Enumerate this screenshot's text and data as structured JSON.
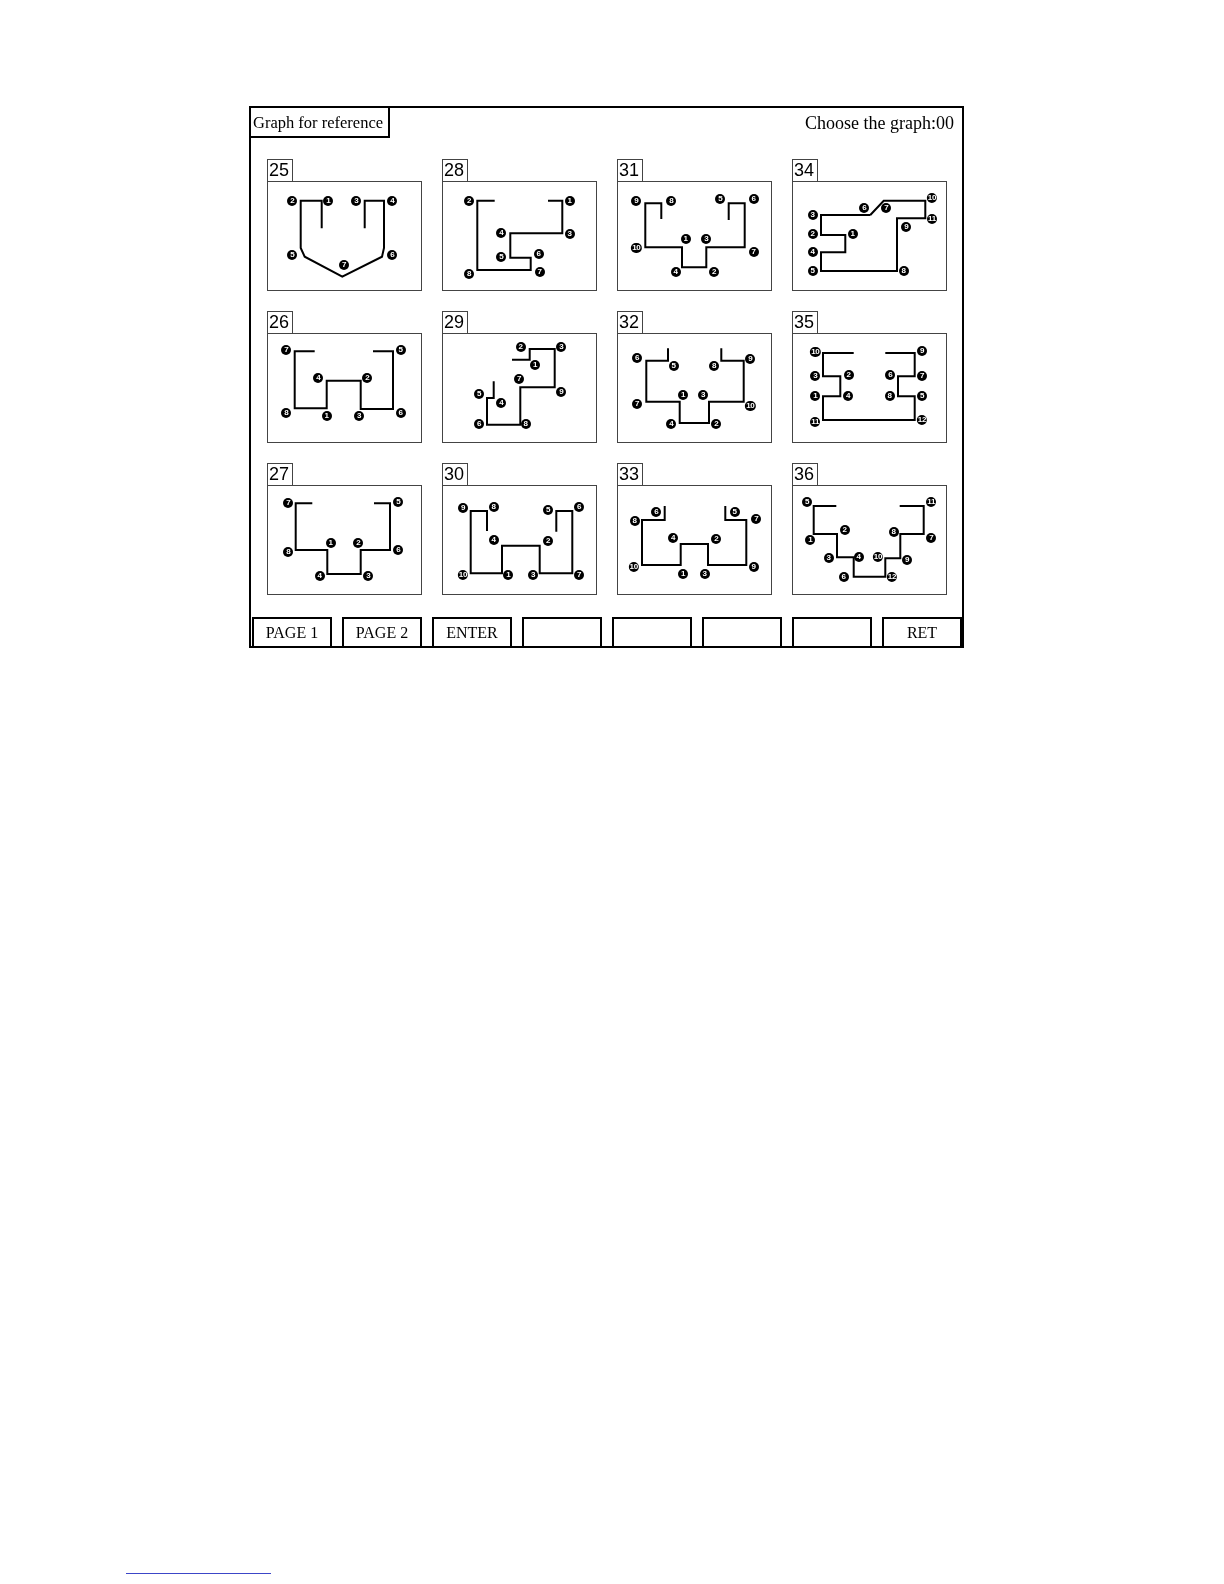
{
  "header": {
    "title": "Graph for reference",
    "prompt": "Choose the graph:00"
  },
  "graphs": [
    {
      "number": "25",
      "nodes": [
        "2",
        "1",
        "3",
        "4",
        "5",
        "6",
        "7"
      ]
    },
    {
      "number": "28",
      "nodes": [
        "2",
        "1",
        "4",
        "3",
        "5",
        "6",
        "8",
        "7"
      ]
    },
    {
      "number": "31",
      "nodes": [
        "9",
        "8",
        "5",
        "6",
        "10",
        "1",
        "3",
        "7",
        "4",
        "2"
      ]
    },
    {
      "number": "34",
      "nodes": [
        "10",
        "6",
        "7",
        "3",
        "11",
        "9",
        "2",
        "1",
        "4",
        "5",
        "8"
      ]
    },
    {
      "number": "26",
      "nodes": [
        "7",
        "5",
        "4",
        "2",
        "8",
        "6",
        "1",
        "3"
      ]
    },
    {
      "number": "29",
      "nodes": [
        "2",
        "3",
        "1",
        "7",
        "9",
        "5",
        "4",
        "6",
        "8"
      ]
    },
    {
      "number": "32",
      "nodes": [
        "6",
        "9",
        "5",
        "8",
        "1",
        "3",
        "7",
        "10",
        "4",
        "2"
      ]
    },
    {
      "number": "35",
      "nodes": [
        "10",
        "9",
        "3",
        "2",
        "6",
        "7",
        "1",
        "4",
        "8",
        "5",
        "11",
        "12"
      ]
    },
    {
      "number": "27",
      "nodes": [
        "7",
        "5",
        "1",
        "2",
        "8",
        "6",
        "4",
        "3"
      ]
    },
    {
      "number": "30",
      "nodes": [
        "9",
        "8",
        "5",
        "6",
        "4",
        "2",
        "10",
        "1",
        "3",
        "7"
      ]
    },
    {
      "number": "33",
      "nodes": [
        "8",
        "6",
        "5",
        "7",
        "4",
        "2",
        "10",
        "1",
        "3",
        "9"
      ]
    },
    {
      "number": "36",
      "nodes": [
        "5",
        "11",
        "2",
        "8",
        "1",
        "7",
        "3",
        "4",
        "10",
        "9",
        "6",
        "12"
      ]
    }
  ],
  "buttons": [
    {
      "kind": "labeled",
      "label": "PAGE 1"
    },
    {
      "kind": "labeled",
      "label": "PAGE 2"
    },
    {
      "kind": "labeled",
      "label": "ENTER"
    },
    {
      "kind": "blank"
    },
    {
      "kind": "blank"
    },
    {
      "kind": "blank"
    },
    {
      "kind": "blank"
    },
    {
      "kind": "labeled",
      "label": "RET"
    }
  ]
}
